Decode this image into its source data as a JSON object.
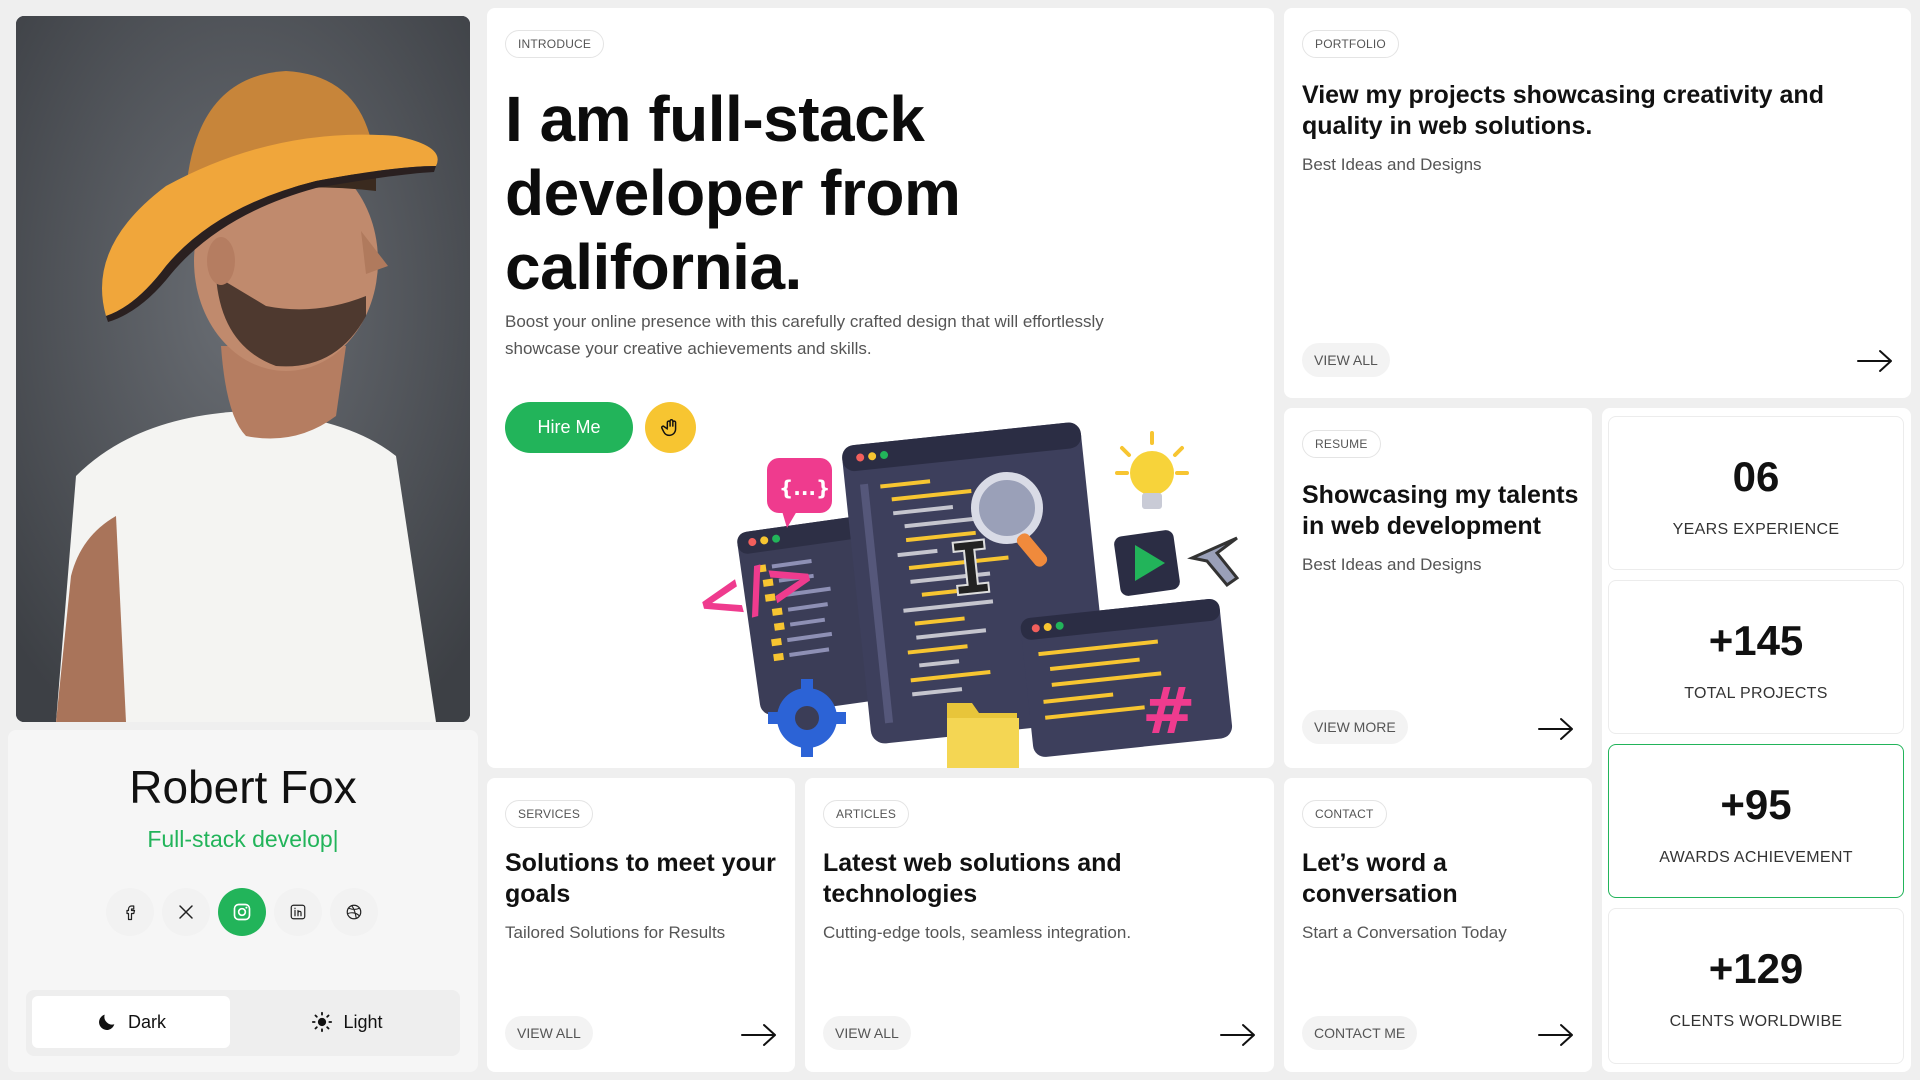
{
  "profile": {
    "name": "Robert Fox",
    "role": "Full-stack develop|",
    "social": [
      {
        "icon": "facebook-icon"
      },
      {
        "icon": "x-icon"
      },
      {
        "icon": "instagram-icon",
        "active": true
      },
      {
        "icon": "linkedin-icon"
      },
      {
        "icon": "dribbble-icon"
      }
    ],
    "theme": {
      "dark": "Dark",
      "light": "Light",
      "selected": "Dark"
    }
  },
  "intro": {
    "tag": "INTRODUCE",
    "headline_1": "I am full-stack",
    "headline_2": "developer from",
    "headline_3": "california.",
    "desc_1": "Boost your online presence with this carefully crafted design that will effortlessly",
    "desc_2": "showcase your creative achievements and skills.",
    "hire_label": "Hire Me"
  },
  "portfolio": {
    "tag": "PORTFOLIO",
    "title_1": "View my projects showcasing creativity and",
    "title_2": "quality in web solutions.",
    "sub": "Best Ideas and Designs",
    "link": "VIEW ALL"
  },
  "resume": {
    "tag": "RESUME",
    "title_1": "Showcasing my talents",
    "title_2": "in web development",
    "sub": "Best Ideas and Designs",
    "link": "VIEW MORE"
  },
  "services": {
    "tag": "SERVICES",
    "title_1": "Solutions to meet your",
    "title_2": "goals",
    "sub": "Tailored Solutions for Results",
    "link": "VIEW ALL"
  },
  "articles": {
    "tag": "ARTICLES",
    "title_1": "Latest web solutions and",
    "title_2": "technologies",
    "sub": "Cutting-edge tools, seamless integration.",
    "link": "VIEW ALL"
  },
  "contact": {
    "tag": "CONTACT",
    "title_1": "Let’s word a",
    "title_2": "conversation",
    "sub": "Start a Conversation Today",
    "link": "CONTACT ME"
  },
  "stats": [
    {
      "num": "06",
      "label": "YEARS EXPERIENCE"
    },
    {
      "num": "+145",
      "label": "TOTAL PROJECTS"
    },
    {
      "num": "+95",
      "label": "AWARDS ACHIEVEMENT",
      "highlight": true
    },
    {
      "num": "+129",
      "label": "CLENTS WORLDWIBE"
    }
  ],
  "colors": {
    "accent_green": "#22b45a",
    "accent_yellow": "#f7c531",
    "background": "#efefef"
  }
}
